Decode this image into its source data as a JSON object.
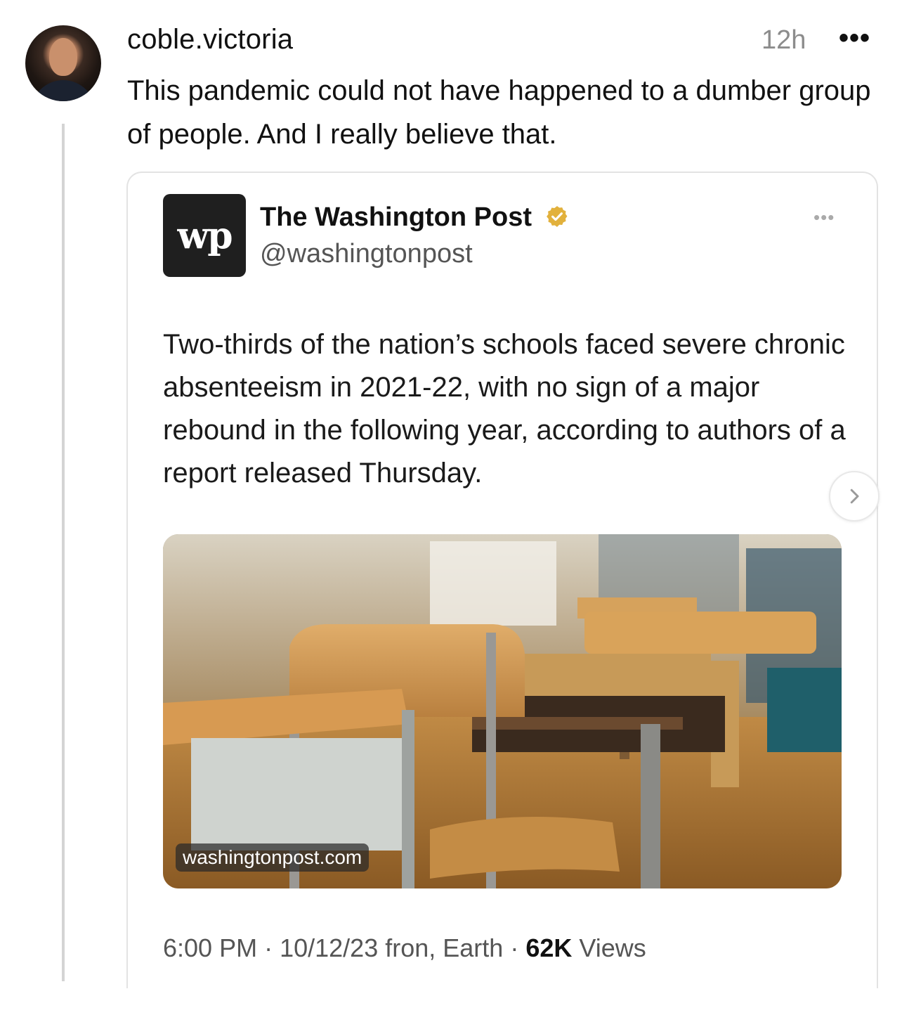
{
  "post": {
    "username": "coble.victoria",
    "time": "12h",
    "more": "•••",
    "text": "This pandemic could not have happened to a dumber group of people. And I really believe that."
  },
  "embed": {
    "source_name": "The Washington Post",
    "source_handle": "@washingtonpost",
    "logo_text": "wp",
    "more": "•••",
    "text": "Two-thirds of the nation’s schools faced severe chronic absenteeism in 2021-22, with no sign of a major rebound in the following year, according to authors of a report released Thursday.",
    "link_domain": "washingtonpost.com",
    "meta_time": "6:00 PM",
    "meta_date": "10/12/23 fron, Earth",
    "views_count": "62K",
    "views_label": "Views"
  },
  "icons": {
    "avatar": "avatar",
    "verified": "verified-badge-icon",
    "next": "chevron-right-icon",
    "more": "more-options-icon"
  },
  "colors": {
    "verified_gold": "#e2b13c",
    "muted": "#8c8c8c",
    "thread_line": "#d4d4d4"
  }
}
